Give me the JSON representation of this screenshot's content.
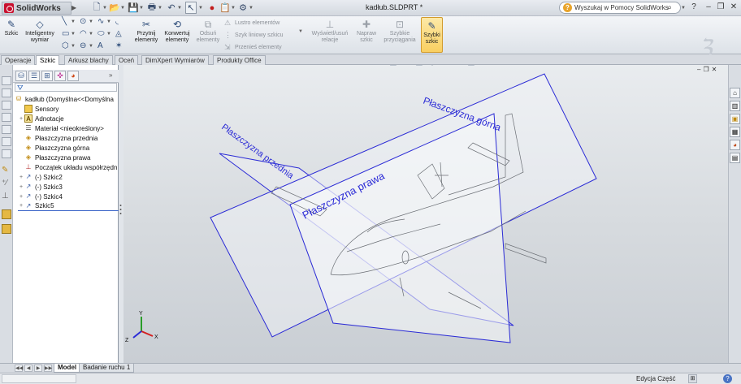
{
  "app": {
    "name": "SolidWorks",
    "document_title": "kadłub.SLDPRT *"
  },
  "help_search": {
    "placeholder": "Wyszukaj w Pomocy SolidWorks"
  },
  "command_manager": {
    "sketch": "Szkic",
    "smart_dimension": "Inteligentny wymiar",
    "trim": "Przytnij elementy",
    "convert": "Konwertuj elementy",
    "offset": "Odsuń elementy",
    "mirror": "Lustro elementów",
    "linear_pattern": "Szyk liniowy szkicu",
    "move": "Przenieś elementy",
    "relations": "Wyświetl/usuń relacje",
    "repair": "Napraw szkic",
    "quick_snaps": "Szybkie przyciągania",
    "rapid_sketch": "Szybki szkic"
  },
  "tabs": [
    "Operacje",
    "Szkic",
    "Arkusz blachy",
    "Oceń",
    "DimXpert Wymiarów",
    "Produkty Office"
  ],
  "active_tab": "Szkic",
  "tree": {
    "root": "kadłub  (Domyślna<<Domyślna",
    "items": [
      {
        "label": "Sensory",
        "icon": "sensors-icon",
        "expand": ""
      },
      {
        "label": "Adnotacje",
        "icon": "annotations-icon",
        "expand": "+"
      },
      {
        "label": "Materiał <nieokreślony>",
        "icon": "material-icon",
        "expand": ""
      },
      {
        "label": "Płaszczyzna przednia",
        "icon": "plane-icon",
        "expand": ""
      },
      {
        "label": "Płaszczyzna górna",
        "icon": "plane-icon",
        "expand": ""
      },
      {
        "label": "Płaszczyzna prawa",
        "icon": "plane-icon",
        "expand": ""
      },
      {
        "label": "Początek układu współrzędn",
        "icon": "origin-icon",
        "expand": ""
      },
      {
        "label": "(-) Szkic2",
        "icon": "sketch-icon",
        "expand": "+"
      },
      {
        "label": "(-) Szkic3",
        "icon": "sketch-icon",
        "expand": "+"
      },
      {
        "label": "(-) Szkic4",
        "icon": "sketch-icon",
        "expand": "+"
      },
      {
        "label": "Szkic5",
        "icon": "sketch-icon",
        "expand": "+"
      }
    ]
  },
  "viewport": {
    "plane_labels": [
      "Płaszczyzna górna",
      "Płaszczyzna przednia",
      "Płaszczyzna prawa"
    ],
    "triad": {
      "x": "X",
      "y": "Y",
      "z": "Z"
    }
  },
  "bottom_tabs": [
    "Model",
    "Badanie ruchu 1"
  ],
  "active_bottom_tab": "Model",
  "status": {
    "mode": "Edycja Część",
    "help": "?"
  },
  "colors": {
    "plane_blue": "#2b2bd6",
    "accent_yellow": "#f9cf61",
    "brand_red": "#c8102e"
  }
}
